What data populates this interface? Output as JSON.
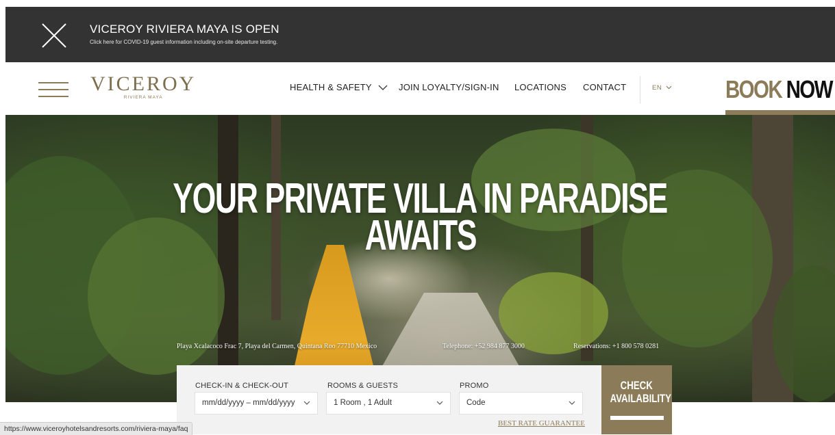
{
  "alert": {
    "title": "VICEROY RIVIERA MAYA IS OPEN",
    "subtitle": "Click here for COVID-19 guest information including on-site departure testing."
  },
  "brand": {
    "name": "VICEROY",
    "location": "RIVIERA MAYA"
  },
  "nav": {
    "health": "HEALTH & SAFETY",
    "loyalty": "JOIN LOYALTY/SIGN-IN",
    "locations": "LOCATIONS",
    "contact": "CONTACT",
    "language": "EN"
  },
  "book_now": {
    "part1": "BOOK",
    "part2": "NOW"
  },
  "hero": {
    "headline_line1": "YOUR PRIVATE VILLA IN PARADISE",
    "headline_line2": "AWAITS",
    "address": "Playa Xcalacoco Frac 7, Playa del Carmen, Quintana Roo 77710 Mexico",
    "telephone": "Telephone: +52 984 877 3000",
    "reservations": "Reservations: +1 800 578 0281"
  },
  "booking": {
    "dates_label": "CHECK-IN & CHECK-OUT",
    "dates_value": "mm/dd/yyyy – mm/dd/yyyy",
    "rooms_label": "ROOMS & GUESTS",
    "rooms_value": "1 Room , 1 Adult",
    "promo_label": "PROMO",
    "promo_value": "Code",
    "guarantee": "BEST RATE GUARANTEE",
    "check_line1": "CHECK",
    "check_line2": "AVAILABILITY"
  },
  "status_url": "https://www.viceroyhotelsandresorts.com/riviera-maya/faq",
  "colors": {
    "gold": "#8c7b58",
    "alert_bg": "#333333",
    "booking_bg": "#f2f2f2"
  },
  "icons": [
    "close-icon",
    "hamburger-menu-icon",
    "chevron-down-icon"
  ]
}
